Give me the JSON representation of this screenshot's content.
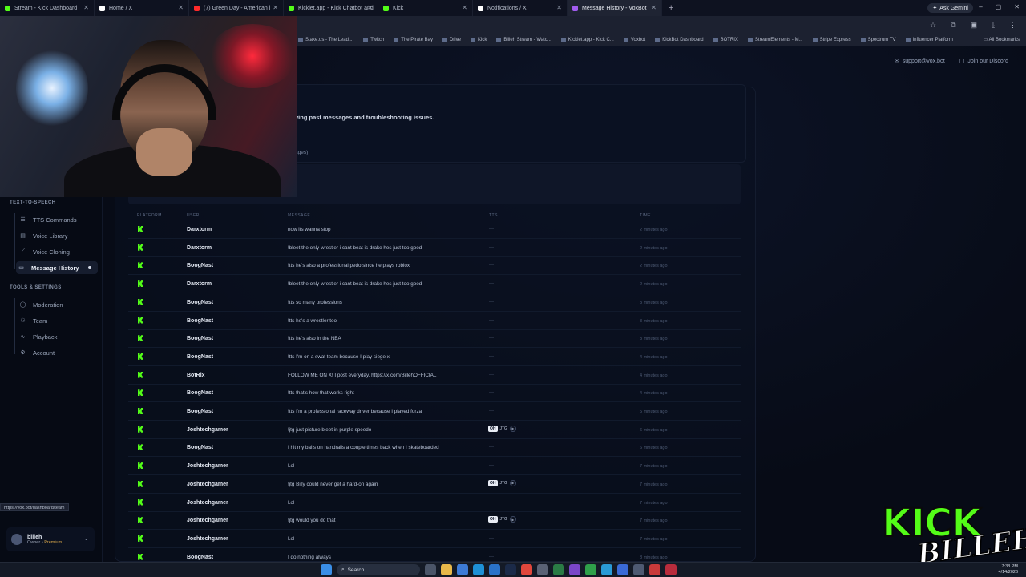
{
  "browser": {
    "tabs": [
      {
        "label": "Stream - Kick Dashboard",
        "color": "#53fc18"
      },
      {
        "label": "Home / X",
        "color": "#ffffff"
      },
      {
        "label": "(7) Green Day - American i",
        "color": "#ff2a2a"
      },
      {
        "label": "Kicklet.app - Kick Chatbot and",
        "color": "#53fc18"
      },
      {
        "label": "Kick",
        "color": "#53fc18"
      },
      {
        "label": "Notifications / X",
        "color": "#ffffff"
      },
      {
        "label": "Message History - VoxBot",
        "color": "#a25cf0",
        "active": true
      }
    ],
    "new_tab": "+",
    "ask_gemini": "Ask Gemini",
    "window_controls": [
      "–",
      "▢",
      "✕"
    ],
    "bookmarks": [
      "Stake.us - The Leadi...",
      "Twitch",
      "The Pirate Bay",
      "Drive",
      "Kick",
      "Billeh Stream - Watc...",
      "Kicklet.app - Kick C...",
      "Voxbot",
      "KickBot Dashboard",
      "BOTRIX",
      "StreamElements - M...",
      "Stripe Express",
      "Spectrum TV",
      "Influencer Platform"
    ],
    "all_bookmarks": "All Bookmarks",
    "status_url": "https://vox.bot/dashboard/team"
  },
  "header": {
    "support": "support@vox.bot",
    "discord": "Join our Discord"
  },
  "sidebar": {
    "sections": [
      {
        "title": "TEXT-TO-SPEECH",
        "items": [
          {
            "label": "TTS Commands",
            "icon": "list-icon"
          },
          {
            "label": "Voice Library",
            "icon": "library-icon"
          },
          {
            "label": "Voice Cloning",
            "icon": "wand-icon"
          },
          {
            "label": "Message History",
            "icon": "history-icon",
            "active": true
          }
        ]
      },
      {
        "title": "TOOLS & SETTINGS",
        "items": [
          {
            "label": "Moderation",
            "icon": "shield-icon"
          },
          {
            "label": "Team",
            "icon": "team-icon"
          },
          {
            "label": "Playback",
            "icon": "waveform-icon"
          },
          {
            "label": "Account",
            "icon": "gear-icon"
          }
        ]
      }
    ],
    "user": {
      "name": "billeh",
      "role": "Owner",
      "plan": "Premium"
    }
  },
  "main": {
    "description": "ving past messages and troubleshooting issues.",
    "sub_note": "ages)",
    "columns": [
      "PLATFORM",
      "USER",
      "MESSAGE",
      "TTS",
      "TIME"
    ],
    "rows": [
      {
        "user": "Darxtorm",
        "message": "now its wanna stop",
        "tts": "—",
        "time": "2 minutes ago"
      },
      {
        "user": "Darxtorm",
        "message": "!bleet the only wrestler i cant beat is drake hes just too good",
        "tts": "—",
        "time": "2 minutes ago"
      },
      {
        "user": "BoogNast",
        "message": "!tts he's also a professional pedo since he plays roblox",
        "tts": "—",
        "time": "2 minutes ago"
      },
      {
        "user": "Darxtorm",
        "message": "!bleet the only wrestler i cant beat is drake hes just too good",
        "tts": "—",
        "time": "2 minutes ago"
      },
      {
        "user": "BoogNast",
        "message": "!tts so many professions",
        "tts": "—",
        "time": "3 minutes ago"
      },
      {
        "user": "BoogNast",
        "message": "!tts he's a wrestler too",
        "tts": "—",
        "time": "3 minutes ago"
      },
      {
        "user": "BoogNast",
        "message": "!tts he's also in the NBA",
        "tts": "—",
        "time": "3 minutes ago"
      },
      {
        "user": "BoogNast",
        "message": "!tts I'm on a swat team because I play siege x",
        "tts": "—",
        "time": "4 minutes ago"
      },
      {
        "user": "BotRix",
        "message": "FOLLOW ME ON X! I post everyday. https://x.com/BillehOFFICIAL",
        "tts": "—",
        "time": "4 minutes ago"
      },
      {
        "user": "BoogNast",
        "message": "!tts that's how that works right",
        "tts": "—",
        "time": "4 minutes ago"
      },
      {
        "user": "BoogNast",
        "message": "!tts I'm a professional raceway driver because I played forza",
        "tts": "—",
        "time": "5 minutes ago"
      },
      {
        "user": "Joshtechgamer",
        "message": "!jtg just picture bleet in purple speedo",
        "tts_badge": {
          "tag": "OH",
          "label": "JTG"
        },
        "time": "6 minutes ago"
      },
      {
        "user": "BoogNast",
        "message": "I hit my balls on handrails a couple times back when I skateboarded",
        "tts": "—",
        "time": "6 minutes ago"
      },
      {
        "user": "Joshtechgamer",
        "message": "Lol",
        "tts": "—",
        "time": "7 minutes ago"
      },
      {
        "user": "Joshtechgamer",
        "message": "!jtg Billy could never get a hard-on again",
        "tts_badge": {
          "tag": "OH",
          "label": "JTG"
        },
        "time": "7 minutes ago"
      },
      {
        "user": "Joshtechgamer",
        "message": "Lol",
        "tts": "—",
        "time": "7 minutes ago"
      },
      {
        "user": "Joshtechgamer",
        "message": "!jtg would you do that",
        "tts_badge": {
          "tag": "OH",
          "label": "JTG"
        },
        "time": "7 minutes ago"
      },
      {
        "user": "Joshtechgamer",
        "message": "Lol",
        "tts": "—",
        "time": "7 minutes ago"
      },
      {
        "user": "BoogNast",
        "message": "I do nothing always",
        "tts": "—",
        "time": "8 minutes ago"
      }
    ]
  },
  "overlay": {
    "kick": "KICK",
    "billeh": "BILLEH"
  },
  "taskbar": {
    "search": "Search",
    "time": "7:38 PM",
    "date": "4/14/2026"
  },
  "colors": {
    "kick_green": "#53fc18",
    "bg": "#070b16"
  }
}
